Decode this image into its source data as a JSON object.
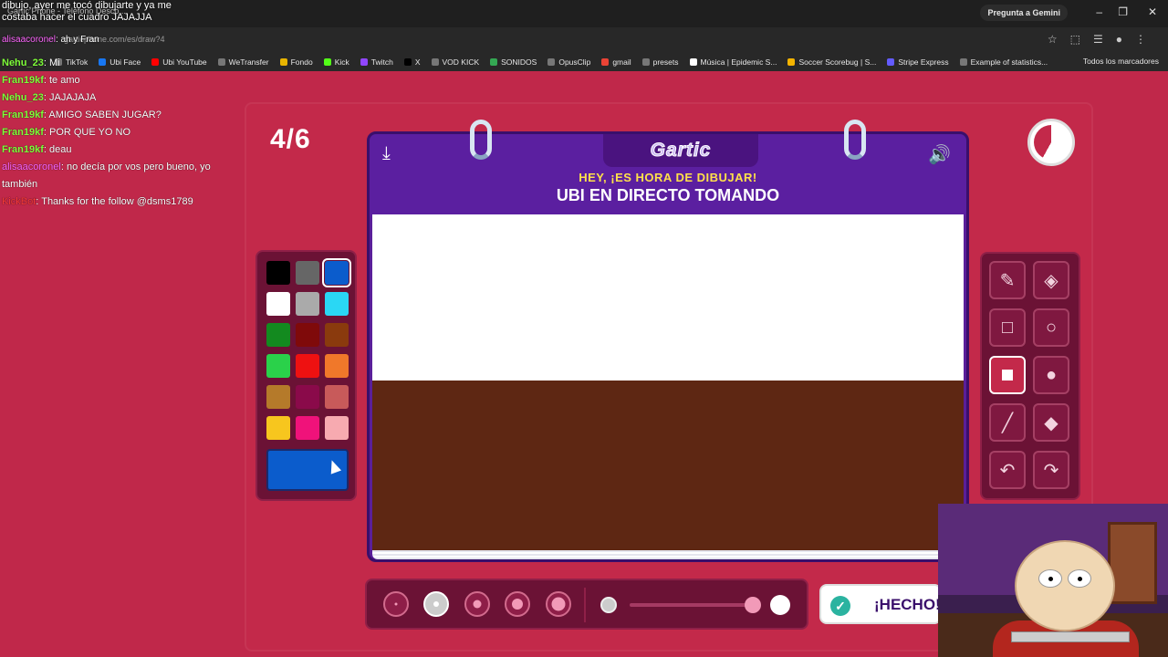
{
  "browser": {
    "tab_title": "Gartic Phone - Teléfono Desco...",
    "url": "garticphone.com/es/draw?4",
    "gemini_label": "Pregunta a Gemini",
    "bookmarks": [
      "TikTok",
      "Ubi Face",
      "Ubi YouTube",
      "WeTransfer",
      "Fondo",
      "Kick",
      "Twitch",
      "X",
      "VOD KICK",
      "SONIDOS",
      "OpusClip",
      "gmail",
      "presets",
      "Música | Epidemic S...",
      "Soccer Scorebug | S...",
      "Stripe Express",
      "Example of statistics..."
    ],
    "bookmarks_all": "Todos los marcadores"
  },
  "chat": {
    "top_text": "dibujo, ayer me tocó dibujarte y ya me costaba hacer el cuadro JAJAJJA",
    "top_user": "alisaacoronel",
    "top_user_msg": "ah y Fran",
    "messages": [
      {
        "user": "Nehu_23",
        "text": "Mi",
        "style": "u"
      },
      {
        "user": "Fran19kf",
        "text": "te amo",
        "style": "u"
      },
      {
        "user": "Nehu_23",
        "text": "JAJAJAJA",
        "style": "u"
      },
      {
        "user": "Fran19kf",
        "text": "AMIGO SABEN JUGAR?",
        "style": "u"
      },
      {
        "user": "Fran19kf",
        "text": "POR QUE YO NO",
        "style": "u"
      },
      {
        "user": "Fran19kf",
        "text": "deau",
        "style": "u"
      },
      {
        "user": "alisaacoronel",
        "text": "no decía por vos pero bueno, yo también",
        "style": "p"
      },
      {
        "user": "KickBot",
        "text": "Thanks for the follow @dsms1789",
        "style": "r"
      }
    ]
  },
  "game": {
    "round": "4/6",
    "logo": "Gartic",
    "subtitle": "HEY, ¡ES HORA DE DIBUJAR!",
    "prompt": "UBI EN DIRECTO TOMANDO",
    "done_label": "¡HECHO!",
    "timer_remaining": 0.58,
    "palette": [
      "#000000",
      "#666666",
      "#0b5ccc",
      "#ffffff",
      "#aaaaaa",
      "#2ad7f4",
      "#138a1f",
      "#7f0a0a",
      "#8a3a0d",
      "#2ad14a",
      "#ee1111",
      "#f0782a",
      "#b57a2a",
      "#8a0a4a",
      "#c85a5a",
      "#f7c61e",
      "#f0127a",
      "#f7aab0"
    ],
    "selected_color": "#0b5ccc",
    "tools": [
      "pencil-icon",
      "eraser-icon",
      "rect-outline-icon",
      "circle-outline-icon",
      "rect-fill-icon",
      "circle-fill-icon",
      "line-icon",
      "fill-bucket-icon",
      "undo-icon",
      "redo-icon"
    ],
    "selected_tool": "rect-fill-icon",
    "brush_sizes": 5,
    "selected_size": 2
  }
}
